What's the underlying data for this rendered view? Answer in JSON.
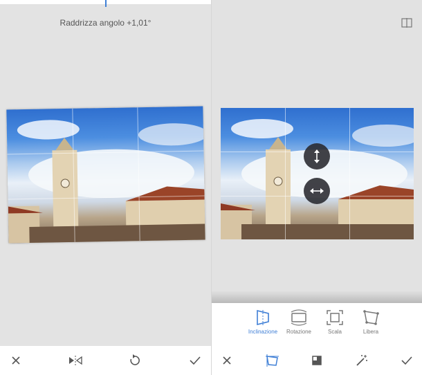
{
  "colors": {
    "accent": "#3f7fd6",
    "icon_gray": "#555555",
    "background": "#e3e3e3"
  },
  "left": {
    "angle_label": "Raddrizza angolo +1,01°",
    "bottom_bar": {
      "icons": [
        "close-icon",
        "flip-icon",
        "rotate-icon",
        "check-icon"
      ]
    }
  },
  "right": {
    "top_icon": "compare-icon",
    "handles": [
      "vertical-tilt-icon",
      "horizontal-tilt-icon"
    ],
    "tools": [
      {
        "label": "Inclinazione",
        "icon": "perspective-tilt-icon",
        "active": true
      },
      {
        "label": "Rotazione",
        "icon": "rotation-icon",
        "active": false
      },
      {
        "label": "Scala",
        "icon": "scale-icon",
        "active": false
      },
      {
        "label": "Libera",
        "icon": "free-transform-icon",
        "active": false
      }
    ],
    "bottom_bar": {
      "icons": [
        "close-icon",
        "perspective-icon",
        "fill-icon",
        "magic-wand-icon",
        "check-icon"
      ]
    }
  }
}
